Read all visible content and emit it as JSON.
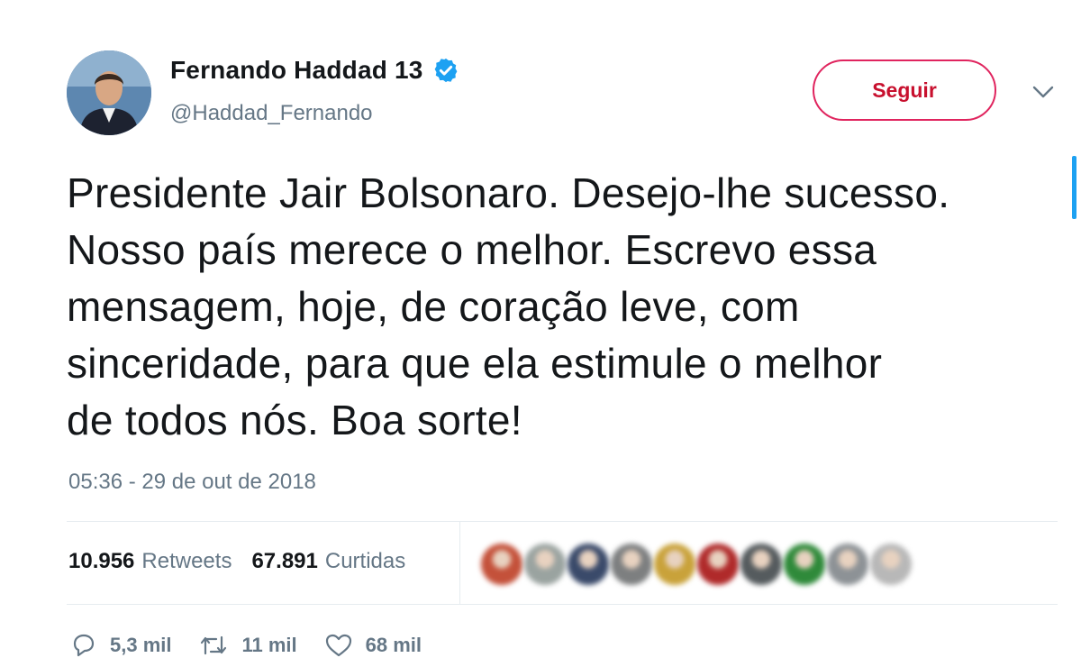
{
  "author": {
    "name": "Fernando Haddad 13",
    "handle": "@Haddad_Fernando",
    "verified": true
  },
  "follow_button": {
    "label": "Seguir",
    "color": "#e0245e"
  },
  "tweet": {
    "text": "Presidente Jair Bolsonaro. Desejo-lhe sucesso.\nNosso país merece o melhor. Escrevo essa\nmensagem, hoje, de coração leve,  com\nsinceridade, para que ela estimule o melhor\nde todos nós. Boa sorte!",
    "timestamp": "05:36 - 29 de out de 2018"
  },
  "stats": {
    "retweets": {
      "count": "10.956",
      "label": "Retweets"
    },
    "likes": {
      "count": "67.891",
      "label": "Curtidas"
    }
  },
  "likers": {
    "count": 10,
    "colors": [
      "#c4513a",
      "#9aa3a0",
      "#3a4a6a",
      "#7d7f80",
      "#c9a23a",
      "#b02a2a",
      "#555b5e",
      "#2f8a3a",
      "#8d9296",
      "#b8b8b8"
    ]
  },
  "actions": {
    "replies": {
      "icon": "reply-icon",
      "count": "5,3 mil"
    },
    "retweets": {
      "icon": "retweet-icon",
      "count": "11 mil"
    },
    "likes": {
      "icon": "heart-icon",
      "count": "68 mil"
    }
  },
  "colors": {
    "accent": "#1da1f2",
    "secondary_text": "#657786",
    "follow_red": "#c8102e"
  }
}
